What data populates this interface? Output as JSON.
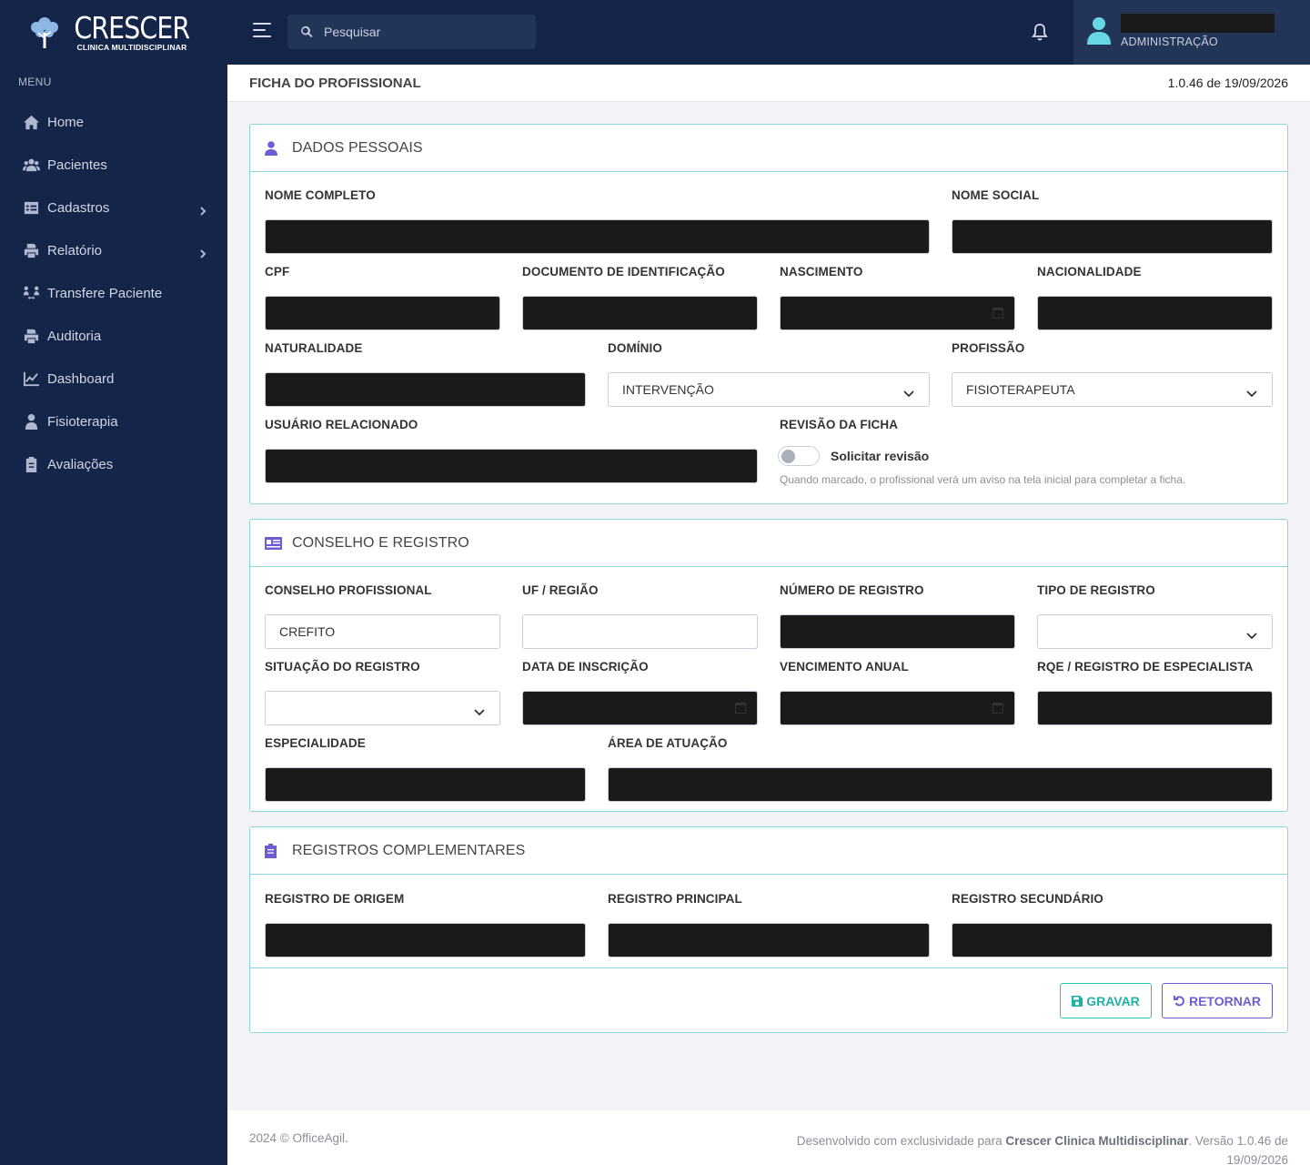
{
  "brand": {
    "name": "CRESCER",
    "tagline": "CLINICA MULTIDISCIPLINAR"
  },
  "sidebar": {
    "menu_label": "MENU",
    "items": [
      {
        "label": "Home",
        "icon": "home-icon",
        "has_submenu": false
      },
      {
        "label": "Pacientes",
        "icon": "users-icon",
        "has_submenu": false
      },
      {
        "label": "Cadastros",
        "icon": "table-icon",
        "has_submenu": true
      },
      {
        "label": "Relatório",
        "icon": "printer-icon",
        "has_submenu": true
      },
      {
        "label": "Transfere Paciente",
        "icon": "people-arrows-icon",
        "has_submenu": false
      },
      {
        "label": "Auditoria",
        "icon": "printer-icon",
        "has_submenu": false
      },
      {
        "label": "Dashboard",
        "icon": "chart-line-icon",
        "has_submenu": false
      },
      {
        "label": "Fisioterapia",
        "icon": "user-doctor-icon",
        "has_submenu": false
      },
      {
        "label": "Avaliações",
        "icon": "clipboard-icon",
        "has_submenu": false
      }
    ]
  },
  "topbar": {
    "search_placeholder": "Pesquisar",
    "user_name": "",
    "user_role": "ADMINISTRAÇÃO"
  },
  "page": {
    "title": "FICHA DO PROFISSIONAL",
    "version": "1.0.46 de 19/09/2026"
  },
  "dados_pessoais": {
    "title": "DADOS PESSOAIS",
    "nome_completo": "NOME COMPLETO",
    "nome_social": "NOME SOCIAL",
    "cpf": "CPF",
    "documento": "DOCUMENTO DE IDENTIFICAÇÃO",
    "nascimento": "NASCIMENTO",
    "nacionalidade": "NACIONALIDADE",
    "naturalidade": "NATURALIDADE",
    "dominio": "DOMÍNIO",
    "dominio_value": "INTERVENÇÃO",
    "profissao": "PROFISSÃO",
    "profissao_value": "FISIOTERAPEUTA",
    "usuario": "USUÁRIO RELACIONADO",
    "revisao": "REVISÃO DA FICHA",
    "revisao_toggle": "Solicitar revisão",
    "revisao_checked": false,
    "revisao_hint": "Quando marcado, o profissional verá um aviso na tela inicial para completar a ficha."
  },
  "conselho": {
    "title": "CONSELHO E REGISTRO",
    "conselho_profissional": "CONSELHO PROFISSIONAL",
    "conselho_value": "CREFITO",
    "uf": "UF / REGIÃO",
    "uf_value": "",
    "numero": "NÚMERO DE REGISTRO",
    "tipo": "TIPO DE REGISTRO",
    "tipo_value": "",
    "situacao": "SITUAÇÃO DO REGISTRO",
    "situacao_value": "",
    "data_inscricao": "DATA DE INSCRIÇÃO",
    "vencimento": "VENCIMENTO ANUAL",
    "rqe": "RQE / REGISTRO DE ESPECIALISTA",
    "especialidade": "ESPECIALIDADE",
    "area": "ÁREA DE ATUAÇÃO"
  },
  "complementares": {
    "title": "REGISTROS COMPLEMENTARES",
    "origem": "REGISTRO DE ORIGEM",
    "principal": "REGISTRO PRINCIPAL",
    "secundario": "REGISTRO SECUNDÁRIO"
  },
  "actions": {
    "save": "GRAVAR",
    "back": "RETORNAR"
  },
  "footer": {
    "left": "2024 © OfficeAgil.",
    "right_prefix": "Desenvolvido com exclusividade para ",
    "right_brand": "Crescer Clinica Multidisciplinar",
    "right_suffix": ". Versão 1.0.46 de 19/09/2026"
  },
  "colors": {
    "sidebar_bg": "#15254a",
    "accent_teal": "#1fb2a5",
    "accent_purple": "#6c5dd3",
    "card_border": "#8fd6dc"
  }
}
